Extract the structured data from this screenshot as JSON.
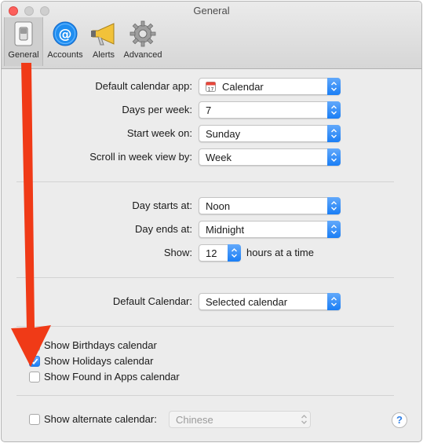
{
  "window": {
    "title": "General"
  },
  "toolbar": {
    "general": "General",
    "accounts": "Accounts",
    "alerts": "Alerts",
    "advanced": "Advanced"
  },
  "settings": {
    "default_app_label": "Default calendar app:",
    "default_app_value": "Calendar",
    "days_per_week_label": "Days per week:",
    "days_per_week_value": "7",
    "start_week_label": "Start week on:",
    "start_week_value": "Sunday",
    "scroll_label": "Scroll in week view by:",
    "scroll_value": "Week",
    "day_starts_label": "Day starts at:",
    "day_starts_value": "Noon",
    "day_ends_label": "Day ends at:",
    "day_ends_value": "Midnight",
    "show_label": "Show:",
    "show_value": "12",
    "show_suffix": "hours at a time",
    "default_calendar_label": "Default Calendar:",
    "default_calendar_value": "Selected calendar"
  },
  "checkboxes": {
    "birthdays": {
      "label": "Show Birthdays calendar",
      "checked": false
    },
    "holidays": {
      "label": "Show Holidays calendar",
      "checked": true
    },
    "found_in_apps": {
      "label": "Show Found in Apps calendar",
      "checked": false
    },
    "alternate": {
      "label": "Show alternate calendar:",
      "checked": false
    }
  },
  "alternate_calendar_value": "Chinese",
  "help_label": "?",
  "colors": {
    "accent": "#1a7ef5",
    "arrow": "#f03a17"
  }
}
